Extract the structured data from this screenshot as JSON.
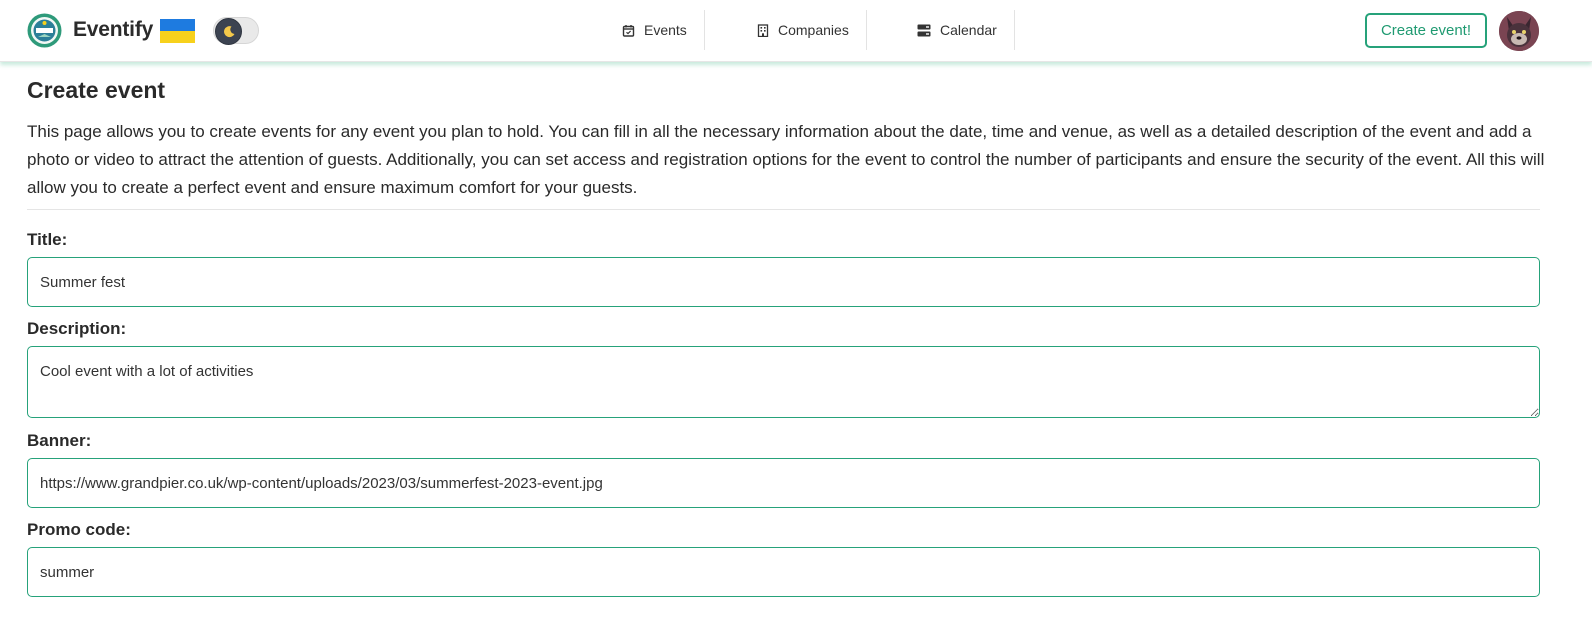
{
  "brand": {
    "name": "Eventify"
  },
  "nav": {
    "items": [
      {
        "label": "Events",
        "icon": "calendar-check-icon"
      },
      {
        "label": "Companies",
        "icon": "building-icon"
      },
      {
        "label": "Calendar",
        "icon": "server-icon"
      }
    ],
    "create_button": "Create event!"
  },
  "page": {
    "title": "Create event",
    "intro": "This page allows you to create events for any event you plan to hold. You can fill in all the necessary information about the date, time and venue, as well as a detailed description of the event and add a photo or video to attract the attention of guests. Additionally, you can set access and registration options for the event to control the number of participants and ensure the security of the event. All this will allow you to create a perfect event and ensure maximum comfort for your guests."
  },
  "form": {
    "title_label": "Title:",
    "title_value": "Summer fest",
    "description_label": "Description:",
    "description_value": "Cool event with a lot of activities",
    "banner_label": "Banner:",
    "banner_value": "https://www.grandpier.co.uk/wp-content/uploads/2023/03/summerfest-2023-event.jpg",
    "promo_label": "Promo code:",
    "promo_value": "summer"
  },
  "colors": {
    "accent": "#26a27a",
    "flag_blue": "#1e7be0",
    "flag_yellow": "#f7d11c"
  }
}
